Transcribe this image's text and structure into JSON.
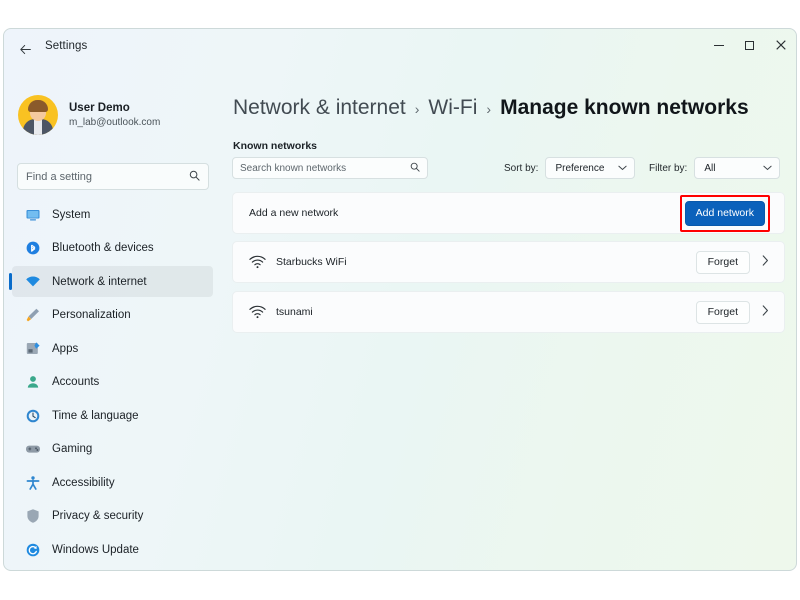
{
  "window": {
    "app_title": "Settings",
    "back_icon": "back-arrow-icon",
    "minimize_label": "–",
    "maximize_label": "□",
    "close_label": "✕"
  },
  "sidebar": {
    "account": {
      "name": "User Demo",
      "email": "m_lab@outlook.com",
      "avatar_icon": "user-avatar"
    },
    "search": {
      "placeholder": "Find a setting",
      "icon": "search-icon"
    },
    "items": [
      {
        "label": "System",
        "icon": "monitor-icon",
        "selected": false
      },
      {
        "label": "Bluetooth & devices",
        "icon": "bluetooth-icon",
        "selected": false
      },
      {
        "label": "Network & internet",
        "icon": "wifi-icon",
        "selected": true
      },
      {
        "label": "Personalization",
        "icon": "paintbrush-icon",
        "selected": false
      },
      {
        "label": "Apps",
        "icon": "apps-grid-icon",
        "selected": false
      },
      {
        "label": "Accounts",
        "icon": "person-icon",
        "selected": false
      },
      {
        "label": "Time & language",
        "icon": "clock-icon",
        "selected": false
      },
      {
        "label": "Gaming",
        "icon": "gamepad-icon",
        "selected": false
      },
      {
        "label": "Accessibility",
        "icon": "accessibility-icon",
        "selected": false
      },
      {
        "label": "Privacy & security",
        "icon": "shield-icon",
        "selected": false
      },
      {
        "label": "Windows Update",
        "icon": "update-refresh-icon",
        "selected": false
      }
    ]
  },
  "content": {
    "breadcrumb": {
      "root": "Network & internet",
      "separator": "›",
      "middle": "Wi-Fi",
      "current": "Manage known networks"
    },
    "section_label": "Known networks",
    "search": {
      "placeholder": "Search known networks",
      "icon": "search-icon"
    },
    "sort": {
      "label": "Sort by:",
      "value": "Preference",
      "chevron_icon": "chevron-down-icon"
    },
    "filter": {
      "label": "Filter by:",
      "value": "All",
      "chevron_icon": "chevron-down-icon"
    },
    "add_network_row": {
      "title": "Add a new network",
      "button_label": "Add network",
      "button_color": "#0b61bb",
      "highlight_color": "#ff0000"
    },
    "networks": [
      {
        "name": "Starbucks WiFi",
        "icon": "wifi-icon",
        "forget_label": "Forget",
        "chevron_icon": "chevron-right-icon"
      },
      {
        "name": "tsunami",
        "icon": "wifi-icon",
        "forget_label": "Forget",
        "chevron_icon": "chevron-right-icon"
      }
    ]
  },
  "theme": {
    "accent": "#0a6cca",
    "selected_nav_accent": "#0a6cca",
    "window_bg_left": "#eef4fb",
    "window_bg_right": "#eef8ec"
  }
}
